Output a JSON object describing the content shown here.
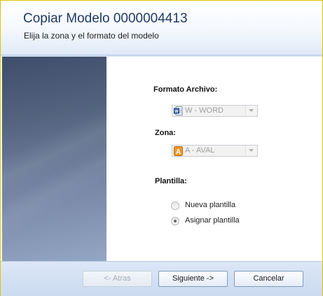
{
  "header": {
    "title": "Copiar Modelo 0000004413",
    "subtitle": "Elija la zona y el formato del modelo"
  },
  "form": {
    "formato": {
      "label": "Formato Archivo:",
      "value": "W - WORD",
      "icon": "word-document-icon"
    },
    "zona": {
      "label": "Zona:",
      "value": "A - AVAL",
      "icon": "letter-a-icon"
    },
    "plantilla": {
      "label": "Plantilla:",
      "options": [
        {
          "label": "Nueva plantilla",
          "selected": false
        },
        {
          "label": "Asignar plantilla",
          "selected": true
        }
      ]
    }
  },
  "footer": {
    "back_label": "<- Atras",
    "next_label": "Siguiente ->",
    "cancel_label": "Cancelar"
  },
  "colors": {
    "window_border": "#e3c300",
    "title_color": "#1f3a66",
    "footer_bg": "#d3e0f3"
  }
}
